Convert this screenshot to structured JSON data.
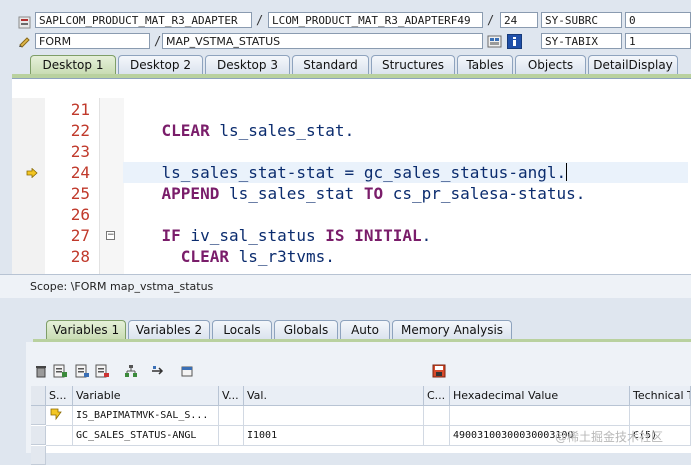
{
  "header": {
    "program": "SAPLCOM_PRODUCT_MAT_R3_ADAPTER",
    "include": "LCOM_PRODUCT_MAT_R3_ADAPTERF49",
    "line": "24",
    "sysvar1_name": "SY-SUBRC",
    "sysvar1_value": "0",
    "event_type": "FORM",
    "event_name": "MAP_VSTMA_STATUS",
    "sysvar2_name": "SY-TABIX",
    "sysvar2_value": "1",
    "separator": "/"
  },
  "desktop_tabs": [
    "Desktop 1",
    "Desktop 2",
    "Desktop 3",
    "Standard",
    "Structures",
    "Tables",
    "Objects",
    "DetailDisplay"
  ],
  "code": {
    "lines": [
      {
        "num": "21",
        "text": ""
      },
      {
        "num": "22",
        "text": "    CLEAR ls_sales_stat."
      },
      {
        "num": "23",
        "text": ""
      },
      {
        "num": "24",
        "text": "    ls_sales_stat-stat = gc_sales_status-angl."
      },
      {
        "num": "25",
        "text": "    APPEND ls_sales_stat TO cs_pr_salesa-status."
      },
      {
        "num": "26",
        "text": ""
      },
      {
        "num": "27",
        "text": "    IF iv_sal_status IS INITIAL."
      },
      {
        "num": "28",
        "text": "      CLEAR ls_r3tvms."
      }
    ],
    "current_line": "24"
  },
  "scope": "Scope: \\FORM map_vstma_status",
  "var_tabs": [
    "Variables 1",
    "Variables 2",
    "Locals",
    "Globals",
    "Auto",
    "Memory Analysis"
  ],
  "grid": {
    "columns": [
      "S...",
      "Variable",
      "V...",
      "Val.",
      "C...",
      "Hexadecimal Value",
      "Technical T"
    ],
    "rows": [
      {
        "variable": "IS_BAPIMATMVK-SAL_S...",
        "value": "",
        "hex": "",
        "tech": ""
      },
      {
        "variable": "GC_SALES_STATUS-ANGL",
        "value": "I1001",
        "hex": "4900310030003000310O",
        "tech": "C(5)"
      }
    ]
  },
  "watermark": "@稀土掘金技术社区",
  "colors": {
    "keyword": "#7a1d6a",
    "identifier": "#0b2c6e",
    "line_number": "#c0392b",
    "active_tab": "#c9dcb4"
  }
}
